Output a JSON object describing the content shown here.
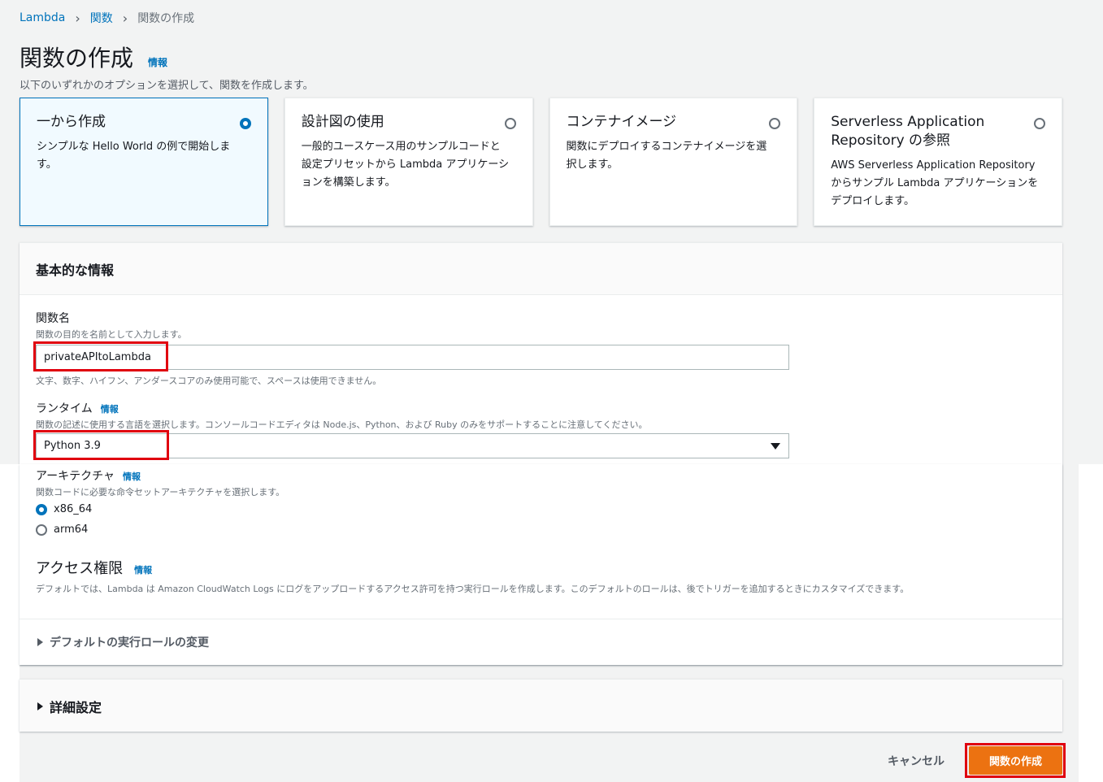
{
  "breadcrumb": {
    "items": [
      "Lambda",
      "関数",
      "関数の作成"
    ]
  },
  "page": {
    "title": "関数の作成",
    "info": "情報",
    "subtitle": "以下のいずれかのオプションを選択して、関数を作成します。"
  },
  "options": [
    {
      "title": "一から作成",
      "desc": "シンプルな Hello World の例で開始します。",
      "selected": true
    },
    {
      "title": "設計図の使用",
      "desc": "一般的ユースケース用のサンプルコードと設定プリセットから Lambda アプリケーションを構築します。",
      "selected": false
    },
    {
      "title": "コンテナイメージ",
      "desc": "関数にデプロイするコンテナイメージを選択します。",
      "selected": false
    },
    {
      "title": "Serverless Application Repository の参照",
      "desc": "AWS Serverless Application Repository からサンプル Lambda アプリケーションをデプロイします。",
      "selected": false
    }
  ],
  "basic": {
    "header": "基本的な情報",
    "function_name": {
      "label": "関数名",
      "desc": "関数の目的を名前として入力します。",
      "value": "privateAPItoLambda",
      "hint": "文字、数字、ハイフン、アンダースコアのみ使用可能で、スペースは使用できません。"
    },
    "runtime": {
      "label": "ランタイム",
      "info": "情報",
      "desc": "関数の記述に使用する言語を選択します。コンソールコードエディタは Node.js、Python、および Ruby のみをサポートすることに注意してください。",
      "value": "Python 3.9"
    },
    "architecture": {
      "label": "アーキテクチャ",
      "info": "情報",
      "desc": "関数コードに必要な命令セットアーキテクチャを選択します。",
      "options": [
        {
          "label": "x86_64",
          "selected": true
        },
        {
          "label": "arm64",
          "selected": false
        }
      ]
    },
    "permissions": {
      "title": "アクセス権限",
      "info": "情報",
      "desc": "デフォルトでは、Lambda は Amazon CloudWatch Logs にログをアップロードするアクセス許可を持つ実行ロールを作成します。このデフォルトのロールは、後でトリガーを追加するときにカスタマイズできます。"
    },
    "role_expander": "デフォルトの実行ロールの変更"
  },
  "advanced": {
    "label": "詳細設定"
  },
  "footer": {
    "cancel": "キャンセル",
    "create": "関数の作成"
  },
  "colors": {
    "link": "#0073bb",
    "primary": "#ec7211",
    "highlight": "#e0010f"
  }
}
